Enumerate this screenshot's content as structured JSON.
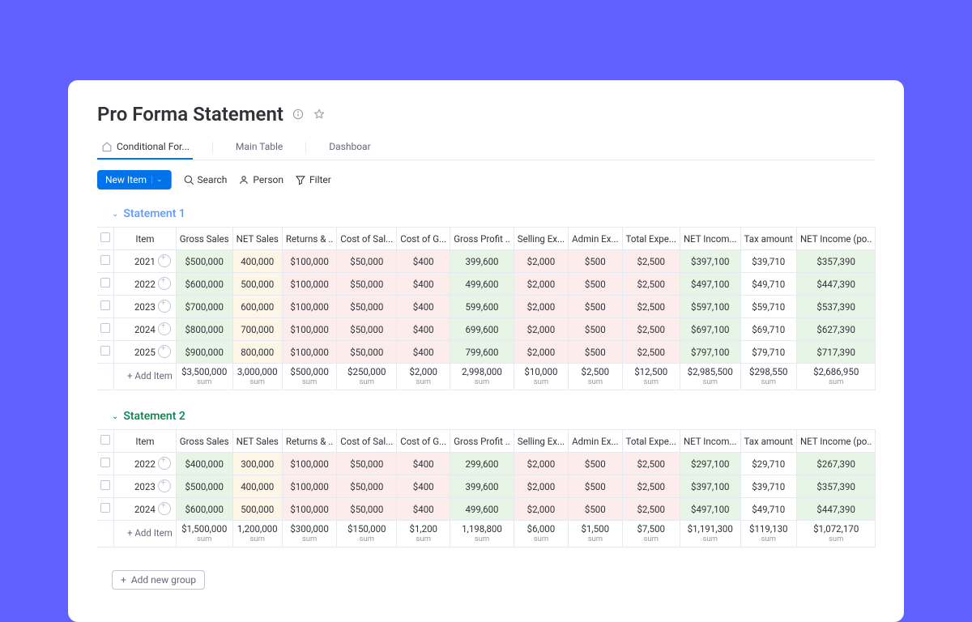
{
  "page": {
    "title": "Pro Forma Statement"
  },
  "tabs": {
    "active": "Conditional For...",
    "main": "Main Table",
    "dash": "Dashboar"
  },
  "toolbar": {
    "new_item": "New Item",
    "search": "Search",
    "person": "Person",
    "filter": "Filter"
  },
  "groups": {
    "s1": {
      "title": "Statement 1",
      "add_item": "+ Add Item",
      "headers": {
        "item": "Item",
        "gross": "Gross Sales",
        "net": "NET Sales",
        "returns": "Returns & ..",
        "costsal": "Cost of Sal...",
        "cog": "Cost of G...",
        "gp": "Gross Profit ..",
        "sell": "Selling Ex...",
        "admin": "Admin Ex...",
        "totexp": "Total Expe...",
        "netinc": "NET Incom...",
        "tax": "Tax amount",
        "netincpo": "NET Income (po.."
      },
      "rows": [
        {
          "item": "2021",
          "gross": "$500,000",
          "net": "400,000",
          "ret": "$100,000",
          "cos": "$50,000",
          "cog": "$400",
          "gp": "399,600",
          "sell": "$2,000",
          "admin": "$500",
          "totexp": "$2,500",
          "netinc": "$397,100",
          "tax": "$39,710",
          "netpo": "$357,390"
        },
        {
          "item": "2022",
          "gross": "$600,000",
          "net": "500,000",
          "ret": "$100,000",
          "cos": "$50,000",
          "cog": "$400",
          "gp": "499,600",
          "sell": "$2,000",
          "admin": "$500",
          "totexp": "$2,500",
          "netinc": "$497,100",
          "tax": "$49,710",
          "netpo": "$447,390"
        },
        {
          "item": "2023",
          "gross": "$700,000",
          "net": "600,000",
          "ret": "$100,000",
          "cos": "$50,000",
          "cog": "$400",
          "gp": "599,600",
          "sell": "$2,000",
          "admin": "$500",
          "totexp": "$2,500",
          "netinc": "$597,100",
          "tax": "$59,710",
          "netpo": "$537,390"
        },
        {
          "item": "2024",
          "gross": "$800,000",
          "net": "700,000",
          "ret": "$100,000",
          "cos": "$50,000",
          "cog": "$400",
          "gp": "699,600",
          "sell": "$2,000",
          "admin": "$500",
          "totexp": "$2,500",
          "netinc": "$697,100",
          "tax": "$69,710",
          "netpo": "$627,390"
        },
        {
          "item": "2025",
          "gross": "$900,000",
          "net": "800,000",
          "ret": "$100,000",
          "cos": "$50,000",
          "cog": "$400",
          "gp": "799,600",
          "sell": "$2,000",
          "admin": "$500",
          "totexp": "$2,500",
          "netinc": "$797,100",
          "tax": "$79,710",
          "netpo": "$717,390"
        }
      ],
      "sums": {
        "gross": "$3,500,000",
        "net": "3,000,000",
        "ret": "$500,000",
        "cos": "$250,000",
        "cog": "$2,000",
        "gp": "2,998,000",
        "sell": "$10,000",
        "admin": "$2,500",
        "totexp": "$12,500",
        "netinc": "$2,985,500",
        "tax": "$298,550",
        "netpo": "$2,686,950",
        "label": "sum"
      }
    },
    "s2": {
      "title": "Statement 2",
      "add_item": "+ Add Item",
      "headers": {
        "item": "Item",
        "gross": "Gross Sales",
        "net": "NET Sales",
        "returns": "Returns & ..",
        "costsal": "Cost of Sal...",
        "cog": "Cost of G...",
        "gp": "Gross Profit ..",
        "sell": "Selling Ex...",
        "admin": "Admin Ex...",
        "totexp": "Total Expe...",
        "netinc": "NET Incom...",
        "tax": "Tax amount",
        "netincpo": "NET Income (po.."
      },
      "rows": [
        {
          "item": "2022",
          "gross": "$400,000",
          "net": "300,000",
          "ret": "$100,000",
          "cos": "$50,000",
          "cog": "$400",
          "gp": "299,600",
          "sell": "$2,000",
          "admin": "$500",
          "totexp": "$2,500",
          "netinc": "$297,100",
          "tax": "$29,710",
          "netpo": "$267,390"
        },
        {
          "item": "2023",
          "gross": "$500,000",
          "net": "400,000",
          "ret": "$100,000",
          "cos": "$50,000",
          "cog": "$400",
          "gp": "399,600",
          "sell": "$2,000",
          "admin": "$500",
          "totexp": "$2,500",
          "netinc": "$397,100",
          "tax": "$39,710",
          "netpo": "$357,390"
        },
        {
          "item": "2024",
          "gross": "$600,000",
          "net": "500,000",
          "ret": "$100,000",
          "cos": "$50,000",
          "cog": "$400",
          "gp": "499,600",
          "sell": "$2,000",
          "admin": "$500",
          "totexp": "$2,500",
          "netinc": "$497,100",
          "tax": "$49,710",
          "netpo": "$447,390"
        }
      ],
      "sums": {
        "gross": "$1,500,000",
        "net": "1,200,000",
        "ret": "$300,000",
        "cos": "$150,000",
        "cog": "$1,200",
        "gp": "1,198,800",
        "sell": "$6,000",
        "admin": "$1,500",
        "totexp": "$7,500",
        "netinc": "$1,191,300",
        "tax": "$119,130",
        "netpo": "$1,072,170",
        "label": "sum"
      }
    }
  },
  "footer": {
    "add_group": "Add new group"
  },
  "colors": {
    "accent": "#0073ea",
    "group_blue": "#579bfc",
    "group_green": "#00854d"
  }
}
